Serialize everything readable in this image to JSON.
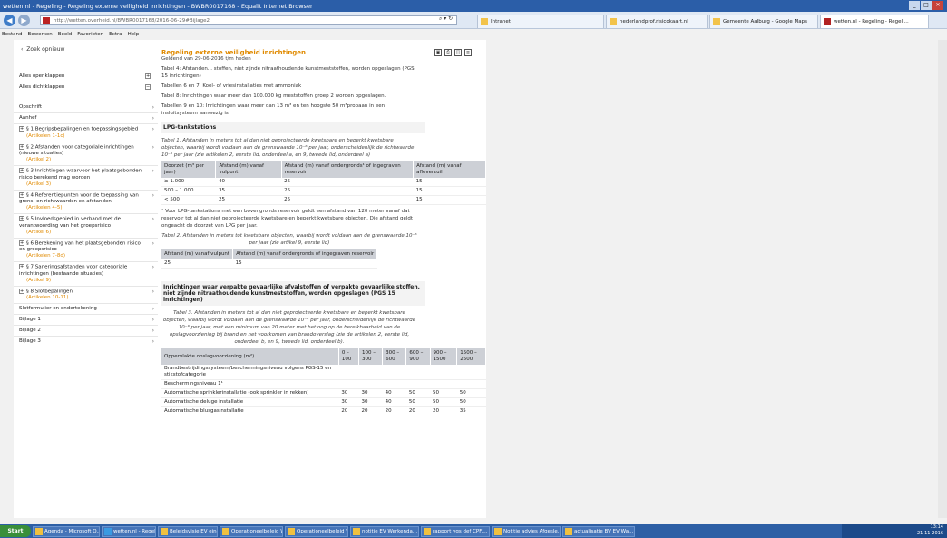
{
  "window": {
    "title": "wetten.nl - Regeling - Regeling externe veiligheid inrichtingen - BWBR0017168 - Equalit Internet Browser"
  },
  "address": {
    "url": "http://wetten.overheid.nl/BWBR0017168/2016-06-29#Bijlage2",
    "icons": "⌕ ▾  ↻"
  },
  "tabs": [
    {
      "label": "Intranet",
      "color": "#f2c34b"
    },
    {
      "label": "nederlandprof.risicokaart.nl",
      "color": "#f2c34b"
    },
    {
      "label": "Gemeente Aalburg - Google Maps",
      "color": "#f2c34b"
    },
    {
      "label": "wetten.nl - Regeling - Regeli...",
      "color": "#b22222"
    }
  ],
  "menu": [
    "Bestand",
    "Bewerken",
    "Beeld",
    "Favorieten",
    "Extra",
    "Help"
  ],
  "sidebar": {
    "back": "Zoek opnieuw",
    "expand": "Alles openklappen",
    "collapse": "Alles dichtklappen",
    "items": [
      {
        "label": "Opschrift",
        "sub": ""
      },
      {
        "label": "Aanhef",
        "sub": ""
      },
      {
        "label": "§ 1  Begripsbepalingen en toepassingsgebied",
        "sub": "(Artikelen 1-1c)"
      },
      {
        "label": "§ 2  Afstanden voor categoriale inrichtingen (nieuwe situaties)",
        "sub": "(Artikel 2)"
      },
      {
        "label": "§ 3  Inrichtingen waarvoor het plaatsgebonden risico berekend mag worden",
        "sub": "(Artikel 3)"
      },
      {
        "label": "§ 4  Referentiepunten voor de toepassing van grens- en richtwaarden en afstanden",
        "sub": "(Artikelen 4-5)"
      },
      {
        "label": "§ 5  Invloedsgebied in verband met de verantwoording van het groepsrisico",
        "sub": "(Artikel 6)"
      },
      {
        "label": "§ 6  Berekening van het plaatsgebonden risico en groepsrisico",
        "sub": "(Artikelen 7-8d)"
      },
      {
        "label": "§ 7  Saneringsafstanden voor categoriale inrichtingen (bestaande situaties)",
        "sub": "(Artikel 9)"
      },
      {
        "label": "§ 8  Slotbepalingen",
        "sub": "(Artikelen 10-11)"
      },
      {
        "label": "Slotformulier en ondertekening",
        "sub": ""
      },
      {
        "label": "Bijlage 1",
        "sub": ""
      },
      {
        "label": "Bijlage 2",
        "sub": ""
      },
      {
        "label": "Bijlage 3",
        "sub": ""
      }
    ]
  },
  "doc": {
    "title": "Regeling externe veiligheid inrichtingen",
    "subtitle": "Geldend van 29-06-2016 t/m heden",
    "intro": "Tabel 4: Afstanden... stoffen, niet zijnde nitraathoudende kunstmeststoffen, worden opgeslagen (PGS 15 inrichtingen)",
    "p1": "Tabellen 6 en 7: Koel- of vriesinstallaties met ammoniak",
    "p2": "Tabel 8: Inrichtingen waar meer dan 100.000 kg meststoffen groep 2 worden opgeslagen.",
    "p3": "Tabellen 9 en 10: Inrichtingen waar meer dan 13 m³ en ten hoogste 50 m³propaan in een insluitsysteem aanwezig is.",
    "h1": "LPG-tankstations",
    "cap1": "Tabel 1. Afstanden in meters tot al dan niet geprojecteerde kwetsbare en beperkt kwetsbare objecten, waarbij wordt voldaan aan de grenswaarde 10⁻⁶ per jaar, onderscheidenlijk de richtwaarde 10⁻⁶ per jaar (zie artikelen 2, eerste lid, onderdeel a, en 9, tweede lid, onderdeel a)",
    "t1": {
      "headers": [
        "Doorzet (m³ per jaar)",
        "Afstand (m) vanaf vulpunt",
        "Afstand (m) vanaf ondergronds¹ of ingegraven reservoir",
        "Afstand (m) vanaf afleverzuil"
      ],
      "rows": [
        [
          "≥ 1.000",
          "40",
          "25",
          "15"
        ],
        [
          "500 – 1.000",
          "35",
          "25",
          "15"
        ],
        [
          "< 500",
          "25",
          "25",
          "15"
        ]
      ]
    },
    "foot1": "¹ Voor LPG-tankstations met een bovengronds reservoir geldt een afstand van 120 meter vanaf dat reservoir tot al dan niet geprojecteerde kwetsbare en beperkt kwetsbare objecten. Die afstand geldt ongeacht de doorzet van LPG per jaar.",
    "cap2": "Tabel 2. Afstanden in meters tot kwetsbare objecten, waarbij wordt voldaan aan de grenswaarde 10⁻⁶ per jaar (zie artikel 9, eerste lid)",
    "t2": {
      "headers": [
        "Afstand (m) vanaf vulpunt",
        "Afstand (m) vanaf ondergronds of ingegraven reservoir"
      ],
      "rows": [
        [
          "25",
          "15"
        ]
      ]
    },
    "h2": "Inrichtingen waar verpakte gevaarlijke afvalstoffen of verpakte gevaarlijke stoffen, niet zijnde nitraathoudende kunstmeststoffen, worden opgeslagen (PGS 15 inrichtingen)",
    "cap3": "Tabel 3. Afstanden in meters tot al dan niet geprojecteerde kwetsbare en beperkt kwetsbare objecten, waarbij wordt voldaan aan de grenswaarde 10⁻⁶ per jaar, onderscheidenlijk de richtwaarde 10⁻⁶ per jaar, met een minimum van 20 meter met het oog op de bereikbaarheid van de opslagvoorziening bij brand en het voorkomen van brandoverslag (zie de artikelen 2, eerste lid, onderdeel b, en 9, tweede lid, onderdeel b).",
    "t3": {
      "headers": [
        "Oppervlakte opslagvoorziening (m²)",
        "0 –100",
        "100 –300",
        "300 –600",
        "600 –900",
        "900 –1500",
        "1500 –2500"
      ],
      "rows": [
        [
          "Brandbestrijdingssysteem/beschermingsniveau volgens PGS-15 en stikstofcategorie",
          "",
          "",
          "",
          "",
          "",
          ""
        ],
        [
          "Beschermingsniveau 1¹",
          "",
          "",
          "",
          "",
          "",
          ""
        ],
        [
          "Automatische sprinklerinstallatie (ook sprinkler in rekken)",
          "30",
          "30",
          "40",
          "50",
          "50",
          "50"
        ],
        [
          "Automatische deluge installatie",
          "30",
          "30",
          "40",
          "50",
          "50",
          "50"
        ],
        [
          "Automatische blusgasinstallatie",
          "20",
          "20",
          "20",
          "20",
          "20",
          "35"
        ]
      ]
    }
  },
  "taskbar": {
    "start": "Start",
    "items": [
      {
        "label": "Agenda - Microsoft O..."
      },
      {
        "label": "wetten.nl - Regelin..."
      },
      {
        "label": "Beleidsvisie EV eindpr..."
      },
      {
        "label": "Operationeelbeleid W..."
      },
      {
        "label": "Operationeelbeleid W..."
      },
      {
        "label": "notitie EV Werkenda..."
      },
      {
        "label": "rapport vgs def CPF...."
      },
      {
        "label": "Notitie advies Afgesle..."
      },
      {
        "label": "actualisatie BV EV Wa..."
      }
    ],
    "time": "13:14",
    "date": "21-11-2016"
  }
}
